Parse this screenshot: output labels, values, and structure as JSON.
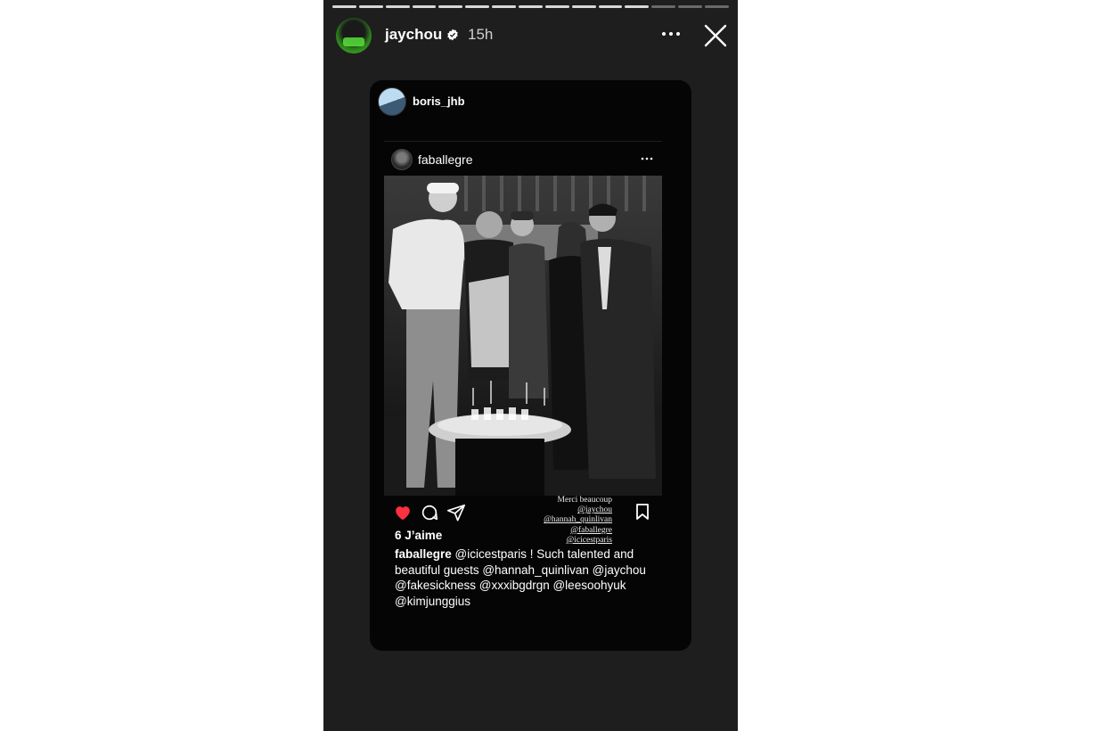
{
  "story": {
    "username": "jaychou",
    "time_ago": "15h",
    "progress_segments_total": 15,
    "progress_segments_viewed": 12
  },
  "shared_post": {
    "sharer": "boris_jhb",
    "author": "faballegre",
    "likes": "6 J’aime",
    "overlay_text": {
      "thanks": "Merci beaucoup",
      "tags": [
        "@jaychou",
        "@hannah_quinlivan",
        "@faballegre",
        "@icicestparis"
      ]
    },
    "caption": {
      "author": "faballegre",
      "text": "@icicestparis ! Such talented and beautiful guests @hannah_quinlivan @jaychou @fakesickness @xxxibgdrgn @leesoohyuk @kimjunggius"
    }
  },
  "icons": {
    "more": "more-icon",
    "close": "close-icon",
    "verified": "verified-badge-icon",
    "like": "heart-icon",
    "comment": "comment-icon",
    "share": "send-icon",
    "save": "bookmark-icon"
  },
  "colors": {
    "story_bg": "#1e1e1e",
    "card_bg": "#050505",
    "like_red": "#ff3040"
  }
}
